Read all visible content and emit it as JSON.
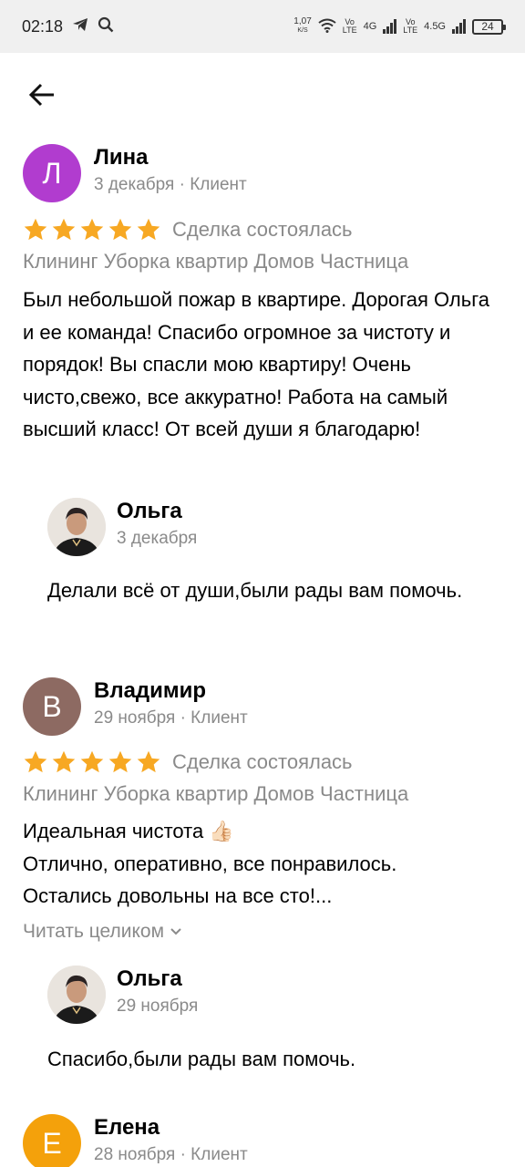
{
  "status_bar": {
    "time": "02:18",
    "net_speed": "1,07",
    "net_unit": "K/S",
    "sim1_label": "4G",
    "sim2_label": "4.5G",
    "volte_top": "Vo",
    "volte_bottom": "LTE",
    "battery": "24",
    "icons": [
      "telegram-icon",
      "search-icon",
      "wifi-icon",
      "signal-icon",
      "battery-icon"
    ]
  },
  "header": {
    "back_icon": "arrow-left-icon"
  },
  "colors": {
    "star": "#f7a823",
    "meta": "#8a8a8a",
    "avatar_l": "#b13ccf",
    "avatar_v": "#8d6a62",
    "avatar_e": "#f4a10b"
  },
  "reviews": [
    {
      "initial": "Л",
      "name": "Лина",
      "meta": "3 декабря · Клиент",
      "rating": 5,
      "deal": "Сделка состоялась",
      "service": "Клининг Уборка квартир Домов Частница",
      "text": "Был небольшой пожар в квартире. Дорогая Ольга и ее команда! Спасибо огромное за чистоту и порядок! Вы спасли мою квартиру! Очень чисто,свежо, все аккуратно! Работа на самый высший класс! От всей души я благодарю!",
      "reply": {
        "name": "Ольга",
        "date": "3 декабря",
        "text": "Делали всё от души,были рады вам помочь."
      }
    },
    {
      "initial": "В",
      "name": "Владимир",
      "meta": "29 ноября · Клиент",
      "rating": 5,
      "deal": "Сделка состоялась",
      "service": "Клининг Уборка квартир Домов Частница",
      "text": "Идеальная чистота 👍🏻\nОтлично, оперативно, все понравилось.\nОстались довольны на все сто!...",
      "read_more": "Читать целиком",
      "reply": {
        "name": "Ольга",
        "date": "29 ноября",
        "text": "Спасибо,были рады вам помочь."
      }
    },
    {
      "initial": "Е",
      "name": "Елена",
      "meta": "28 ноября · Клиент"
    }
  ]
}
